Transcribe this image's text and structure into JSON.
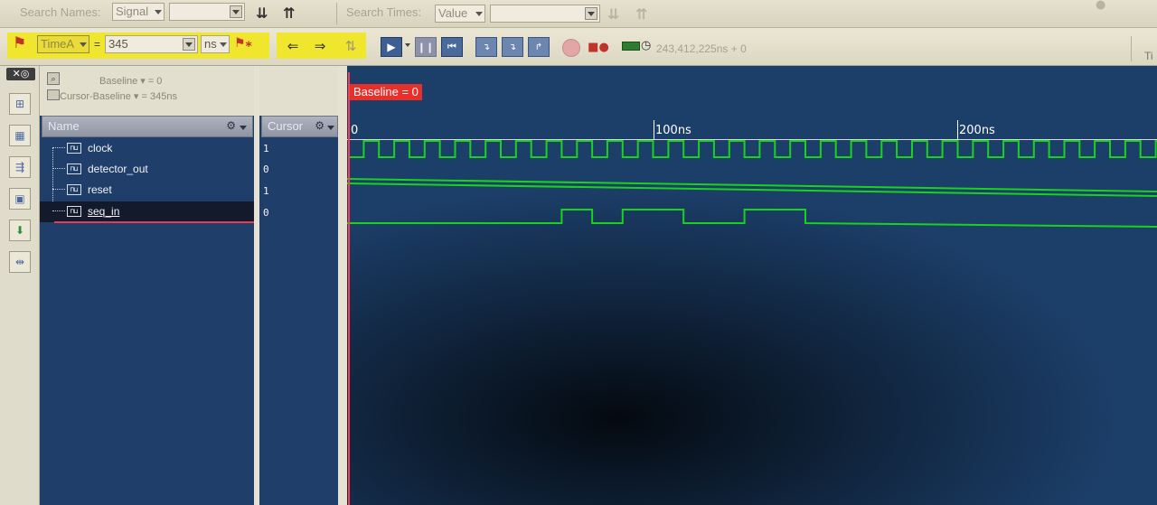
{
  "search_bar": {
    "search_names_label": "Search Names:",
    "names_filter": "Signal",
    "names_text": "",
    "search_times_label": "Search Times:",
    "times_filter": "Value",
    "times_text": ""
  },
  "toolbar": {
    "time_marker": "TimeA",
    "equals": "=",
    "time_value": "345",
    "time_unit": "ns",
    "sim_time": "243,412,225ns + 0",
    "right_label": "Ti"
  },
  "panel": {
    "baseline": "Baseline ▾ = 0",
    "cursor_baseline": "Cursor-Baseline ▾ = 345ns",
    "name_header": "Name",
    "cursor_header": "Cursor"
  },
  "signals": [
    {
      "name": "clock",
      "value": "1",
      "icon": "waveform-icon"
    },
    {
      "name": "detector_out",
      "value": "0",
      "icon": "waveform-icon"
    },
    {
      "name": "reset",
      "value": "1",
      "icon": "waveform-icon"
    },
    {
      "name": "seq_in",
      "value": "0",
      "icon": "waveform-icon"
    }
  ],
  "wave": {
    "baseline_badge": "Baseline = 0",
    "time_labels": [
      "0",
      "100ns",
      "200ns"
    ],
    "clock_period_ns": 10,
    "seq_in_high_ns": [
      [
        70,
        80
      ],
      [
        90,
        110
      ],
      [
        130,
        150
      ]
    ],
    "signal_color": "#19d31b",
    "background_color": "#1c3f6a",
    "baseline_color": "#ff3d4f"
  }
}
